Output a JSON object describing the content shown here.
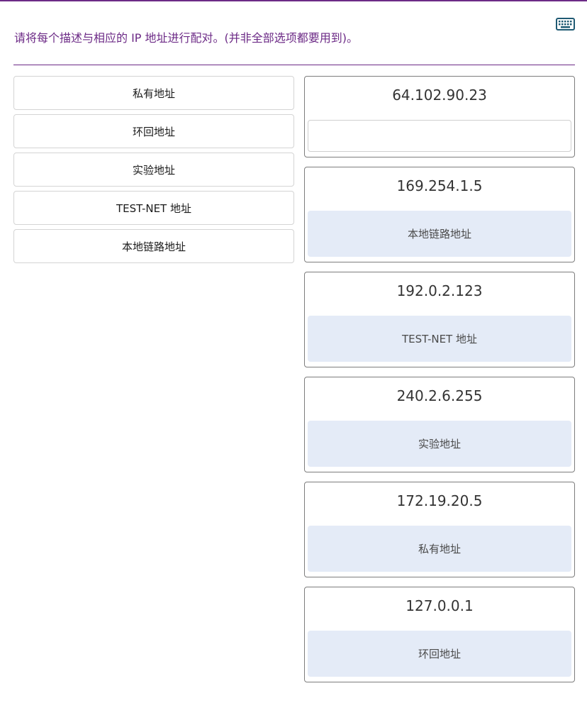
{
  "instruction": "请将每个描述与相应的 IP 地址进行配对。(并非全部选项都要用到)。",
  "keyboard_icon": "keyboard-icon",
  "colors": {
    "accent": "#6c2a86",
    "filled_zone": "#e4ebf7"
  },
  "options": [
    {
      "label": "私有地址"
    },
    {
      "label": "环回地址"
    },
    {
      "label": "实验地址"
    },
    {
      "label": "TEST-NET 地址"
    },
    {
      "label": "本地链路地址"
    }
  ],
  "targets": [
    {
      "ip": "64.102.90.23",
      "answer": ""
    },
    {
      "ip": "169.254.1.5",
      "answer": "本地链路地址"
    },
    {
      "ip": "192.0.2.123",
      "answer": "TEST-NET 地址"
    },
    {
      "ip": "240.2.6.255",
      "answer": "实验地址"
    },
    {
      "ip": "172.19.20.5",
      "answer": "私有地址"
    },
    {
      "ip": "127.0.0.1",
      "answer": "环回地址"
    }
  ]
}
